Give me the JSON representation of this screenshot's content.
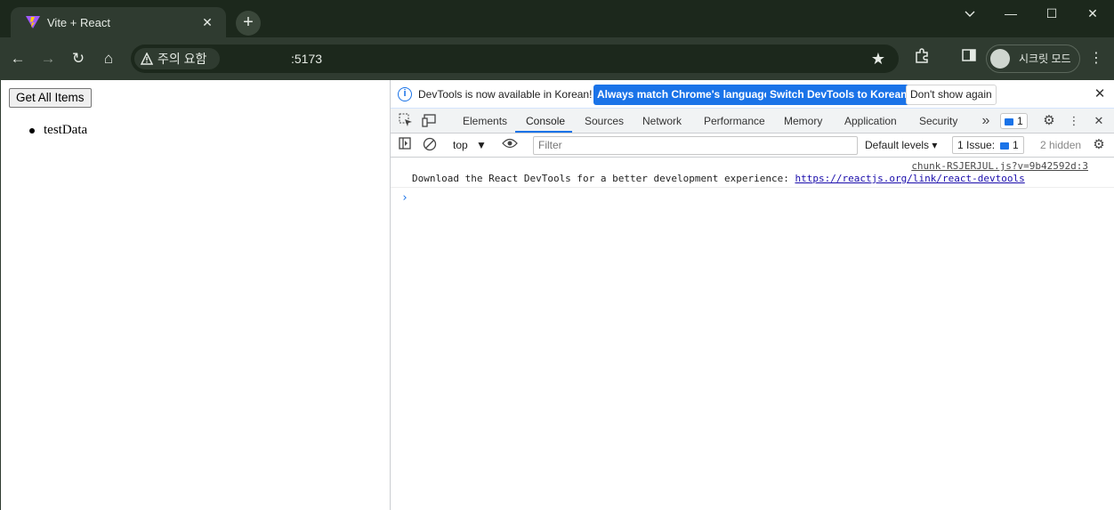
{
  "browser": {
    "tab": {
      "title": "Vite + React",
      "close": "✕"
    },
    "newtab": "+",
    "window_controls": {
      "minimize": "—",
      "maximize": "☐",
      "close": "✕"
    },
    "nav": {
      "back": "←",
      "forward": "→",
      "reload": "↻",
      "home": "⌂"
    },
    "omnibox": {
      "security_chip": "주의 요함",
      "url": ":5173"
    },
    "incognito_label": "시크릿 모드"
  },
  "page": {
    "button_label": "Get All Items",
    "items": [
      "testData"
    ]
  },
  "devtools": {
    "infobar": {
      "message": "DevTools is now available in Korean!",
      "primary1": "Always match Chrome's language",
      "primary2": "Switch DevTools to Korean",
      "secondary": "Don't show again"
    },
    "tabs": [
      "Elements",
      "Console",
      "Sources",
      "Network",
      "Performance",
      "Memory",
      "Application",
      "Security"
    ],
    "active_tab": "Console",
    "more_tabs": "»",
    "issues_badge_count": "1",
    "console_toolbar": {
      "context": "top",
      "filter_placeholder": "Filter",
      "levels": "Default levels",
      "issues": "1 Issue:",
      "issues_count": "1",
      "hidden": "2 hidden"
    },
    "messages": [
      {
        "source": "chunk-RSJERJUL.js?v=9b42592d:3",
        "text": "Download the React DevTools for a better development experience: ",
        "link": "https://reactjs.org/link/react-devtools"
      }
    ],
    "prompt": "›"
  },
  "colors": {
    "frame": "#1c281c",
    "toolbar": "#2f3b30",
    "accent": "#1a73e8"
  }
}
